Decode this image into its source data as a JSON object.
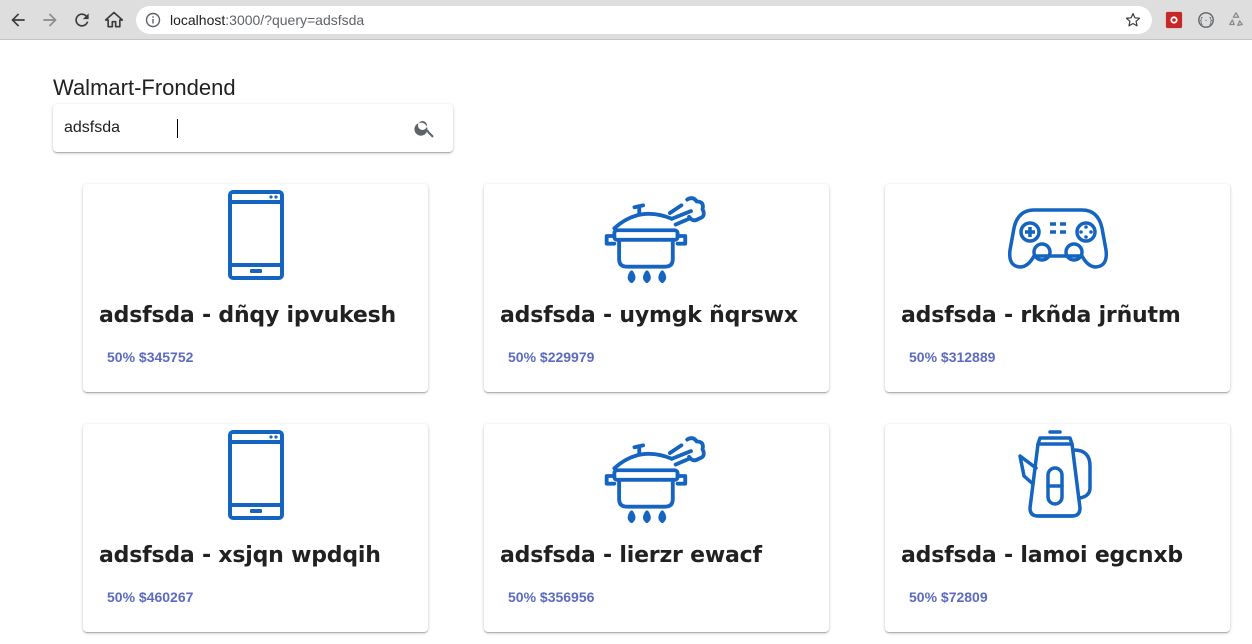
{
  "browser": {
    "url_host": "localhost",
    "url_rest": ":3000/?query=adsfsda",
    "icons": [
      "back-icon",
      "forward-icon",
      "reload-icon",
      "home-icon",
      "info-icon",
      "star-icon"
    ]
  },
  "app": {
    "title": "Walmart-Frondend",
    "search": {
      "value": "adsfsda"
    }
  },
  "products": [
    {
      "icon": "smartphone-icon",
      "title": "adsfsda - dñqy ipvukesh",
      "price": "50% $345752"
    },
    {
      "icon": "cooking-pot-icon",
      "title": "adsfsda - uymgk ñqrswx",
      "price": "50% $229979"
    },
    {
      "icon": "gamepad-icon",
      "title": "adsfsda - rkñda jrñutm",
      "price": "50% $312889"
    },
    {
      "icon": "smartphone-icon",
      "title": "adsfsda - xsjqn wpdqih",
      "price": "50% $460267"
    },
    {
      "icon": "cooking-pot-icon",
      "title": "adsfsda - lierzr ewacf",
      "price": "50% $356956"
    },
    {
      "icon": "kettle-icon",
      "title": "adsfsda - lamoi egcnxb",
      "price": "50% $72809"
    }
  ],
  "colors": {
    "icon": "#1565c0",
    "price": "#5c6bc0",
    "text": "#212121"
  }
}
